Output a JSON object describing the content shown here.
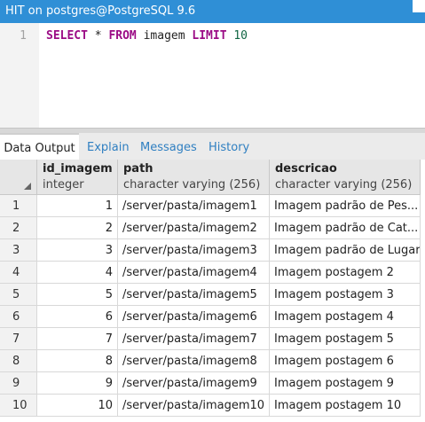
{
  "window": {
    "title": "HIT on postgres@PostgreSQL 9.6"
  },
  "editor": {
    "line_number": "1",
    "query": {
      "select": "SELECT",
      "star": " * ",
      "from": "FROM",
      "table": " imagem ",
      "limit": "LIMIT",
      "value": " 10"
    }
  },
  "tabs": [
    {
      "label": "Data Output",
      "active": true
    },
    {
      "label": "Explain"
    },
    {
      "label": "Messages"
    },
    {
      "label": "History"
    }
  ],
  "grid": {
    "columns": [
      {
        "name": "id_imagem",
        "type": "integer"
      },
      {
        "name": "path",
        "type": "character varying (256)"
      },
      {
        "name": "descricao",
        "type": "character varying (256)"
      }
    ],
    "rows": [
      {
        "n": "1",
        "id": "1",
        "path": "/server/pasta/imagem1",
        "desc": "Imagem padrão de Pes..."
      },
      {
        "n": "2",
        "id": "2",
        "path": "/server/pasta/imagem2",
        "desc": "Imagem padrão de Cat..."
      },
      {
        "n": "3",
        "id": "3",
        "path": "/server/pasta/imagem3",
        "desc": "Imagem padrão de Lugar"
      },
      {
        "n": "4",
        "id": "4",
        "path": "/server/pasta/imagem4",
        "desc": "Imagem postagem 2"
      },
      {
        "n": "5",
        "id": "5",
        "path": "/server/pasta/imagem5",
        "desc": "Imagem postagem 3"
      },
      {
        "n": "6",
        "id": "6",
        "path": "/server/pasta/imagem6",
        "desc": "Imagem postagem 4"
      },
      {
        "n": "7",
        "id": "7",
        "path": "/server/pasta/imagem7",
        "desc": "Imagem postagem 5"
      },
      {
        "n": "8",
        "id": "8",
        "path": "/server/pasta/imagem8",
        "desc": "Imagem postagem 6"
      },
      {
        "n": "9",
        "id": "9",
        "path": "/server/pasta/imagem9",
        "desc": "Imagem postagem 9"
      },
      {
        "n": "10",
        "id": "10",
        "path": "/server/pasta/imagem10",
        "desc": "Imagem postagem 10"
      }
    ]
  }
}
